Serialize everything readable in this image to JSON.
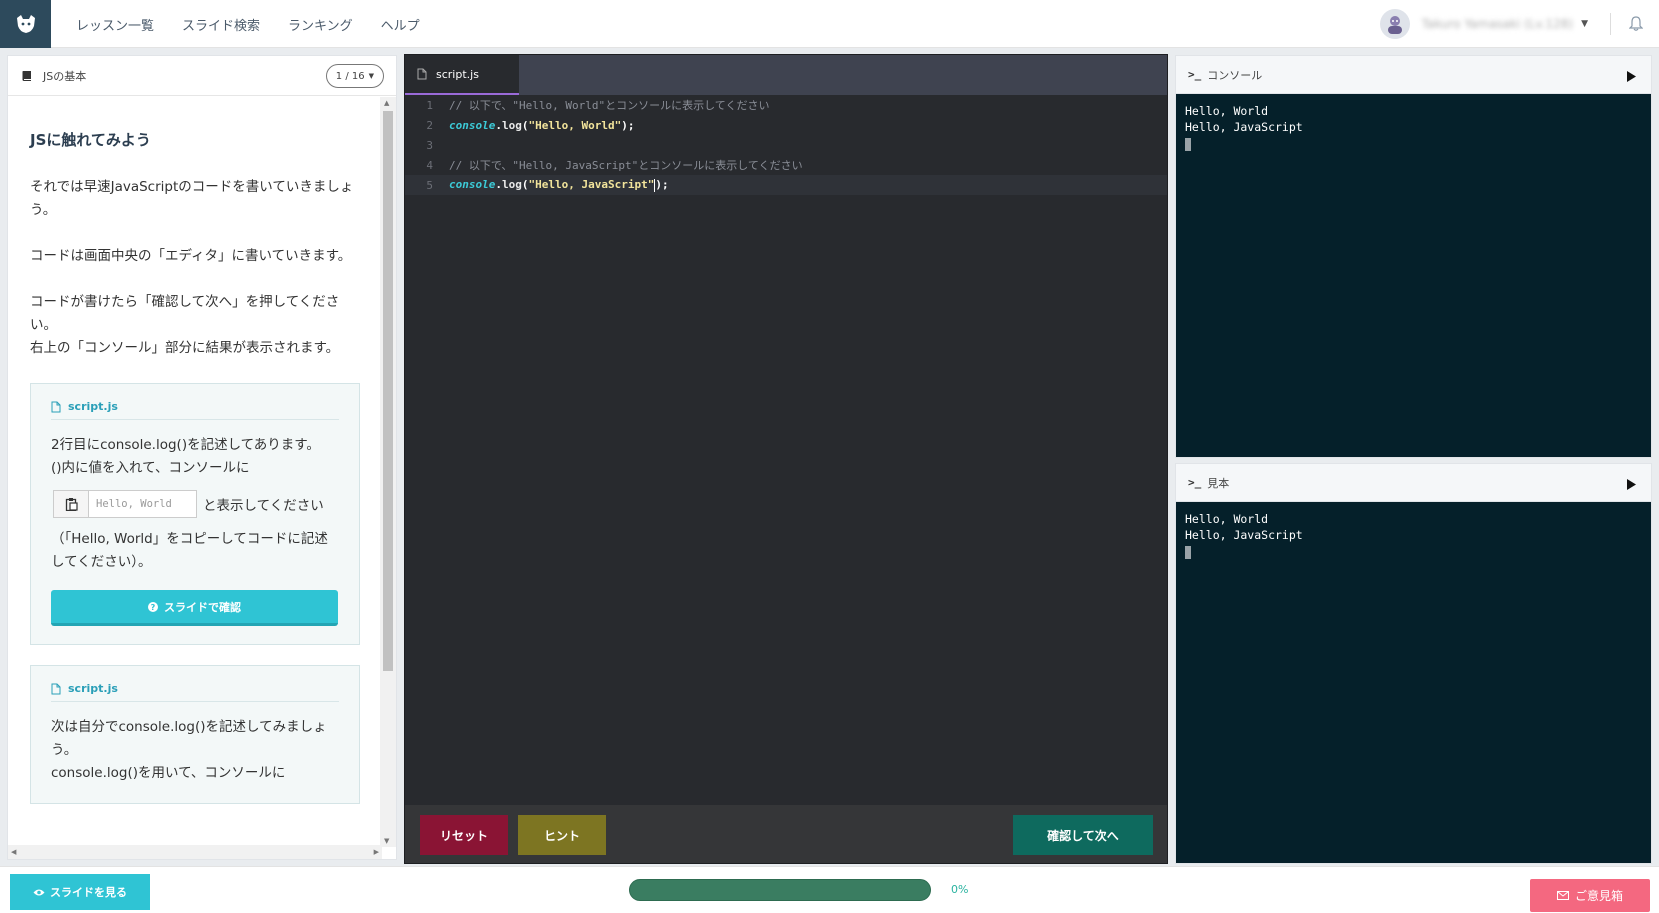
{
  "header": {
    "nav": [
      "レッスン一覧",
      "スライド検索",
      "ランキング",
      "ヘルプ"
    ],
    "user_name": "Takuro Yamasaki (Lv.128)"
  },
  "lesson": {
    "title": "JSの基本",
    "page": "1 / 16",
    "heading": "JSに触れてみよう",
    "paragraphs": [
      "それでは早速JavaScriptのコードを書いていきましょう。",
      "コードは画面中央の「エディタ」に書いていきます。",
      "コードが書けたら「確認して次へ」を押してください。\n右上の「コンソール」部分に結果が表示されます。"
    ],
    "card1": {
      "file": "script.js",
      "text1": "2行目にconsole.log()を記述してあります。\n()内に値を入れて、コンソールに",
      "input_value": "Hello, World",
      "after_input": "と表示してください",
      "text2": "（「Hello, World」をコピーしてコードに記述してください）。",
      "button": "スライドで確認"
    },
    "card2": {
      "file": "script.js",
      "text1": "次は自分でconsole.log()を記述してみましょう。\nconsole.log()を用いて、コンソールに"
    }
  },
  "editor": {
    "tab": "script.js",
    "lines": [
      {
        "n": "1",
        "comment": "// 以下で、\"Hello, World\"とコンソールに表示してください"
      },
      {
        "n": "2",
        "obj": "console",
        "dot": ".",
        "method": "log",
        "open": "(",
        "str": "\"Hello, World\"",
        "close": ");"
      },
      {
        "n": "3"
      },
      {
        "n": "4",
        "comment": "// 以下で、\"Hello, JavaScript\"とコンソールに表示してください"
      },
      {
        "n": "5",
        "obj": "console",
        "dot": ".",
        "method": "log",
        "open": "(",
        "str": "\"Hello, JavaScript\"",
        "close": ");"
      }
    ],
    "reset_label": "リセット",
    "hint_label": "ヒント",
    "next_label": "確認して次へ"
  },
  "console": {
    "prompt": ">_",
    "title": "コンソール",
    "output": [
      "Hello, World",
      "Hello, JavaScript"
    ]
  },
  "sample": {
    "prompt": ">_",
    "title": "見本",
    "output": [
      "Hello, World",
      "Hello, JavaScript"
    ]
  },
  "footer": {
    "view_slides": "スライドを見る",
    "progress": "0%",
    "progress_value": 0,
    "feedback": "ご意見箱"
  },
  "colors": {
    "accent": "#2fc4d4",
    "reset": "#8a1434",
    "hint": "#7d7522",
    "next": "#0e6a5e",
    "console_bg": "#05202a",
    "feedback": "#f46880"
  }
}
